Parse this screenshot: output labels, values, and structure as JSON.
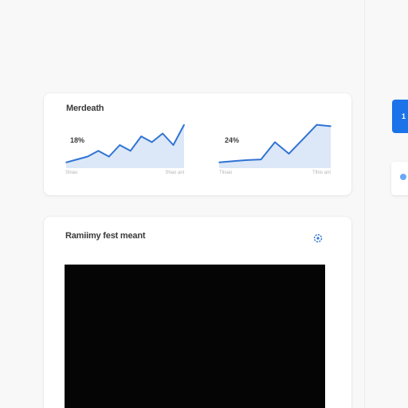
{
  "colors": {
    "accent": "#1a73e8",
    "line": "#2f73d4",
    "area": "#dce7f8",
    "preview": "#050505"
  },
  "metrics_card": {
    "title": "Merdeath"
  },
  "upload_card": {
    "title": "Ramiimy fest meant",
    "icon": "gear-icon"
  },
  "side_button": {
    "label": "1"
  },
  "chart_data": [
    {
      "type": "area",
      "title": "",
      "annotation": "18%",
      "x": [
        "Shiao",
        "Shao anl"
      ],
      "xtick_labels": [
        "Shiao",
        "Shao anl"
      ],
      "values": [
        2,
        3,
        4,
        6,
        4,
        8,
        6,
        11,
        9,
        12,
        8,
        15
      ],
      "ylim": [
        0,
        16
      ]
    },
    {
      "type": "area",
      "title": "",
      "annotation": "24%",
      "xtick_labels": [
        "Tlioao",
        "Tlhio ant"
      ],
      "values": [
        2,
        2.4,
        2.8,
        3,
        9,
        5,
        10,
        15,
        14.5
      ],
      "ylim": [
        0,
        16
      ]
    }
  ]
}
